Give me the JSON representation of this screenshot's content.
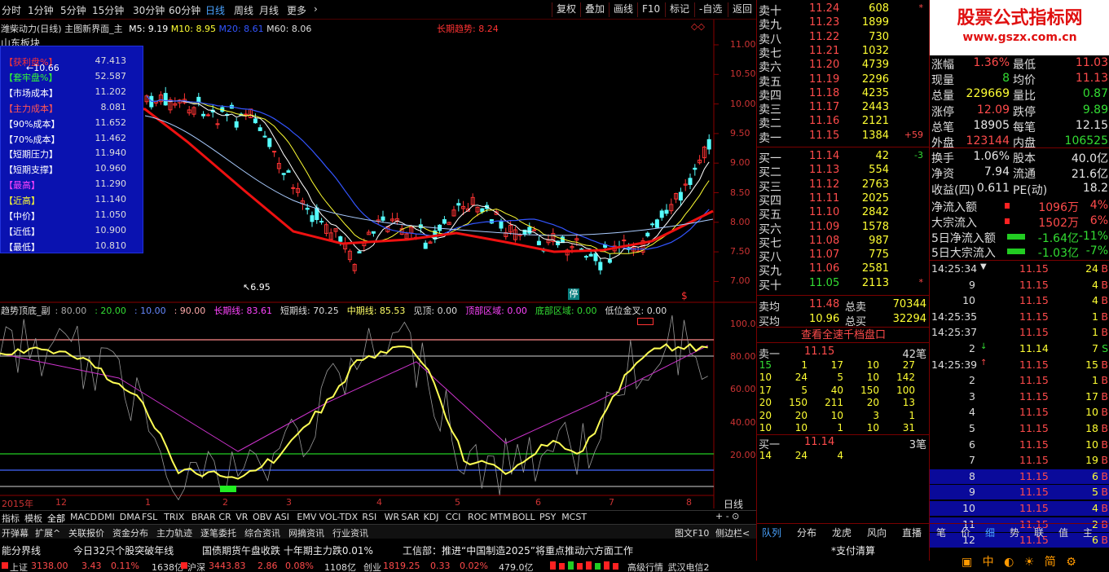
{
  "toolbar": {
    "periods": [
      "分时",
      "1分钟",
      "5分钟",
      "15分钟",
      "30分钟",
      "60分钟",
      "日线",
      "周线",
      "月线",
      "更多"
    ],
    "active_period": "日线",
    "right": [
      "复权",
      "叠加",
      "画线",
      "F10",
      "标记",
      "-自选",
      "返回"
    ]
  },
  "header": {
    "stock": "潍柴动力(日线)",
    "screen": "主图新界面_主",
    "ma": [
      "M5: 9.19",
      "M10: 8.95",
      "M20: 8.61",
      "M60: 8.06"
    ],
    "trend": "长期趋势: 8.24",
    "sector": "山东板块"
  },
  "info_box": [
    {
      "k": "【获利盘%】",
      "v": "47.413",
      "c": "#ff3333"
    },
    {
      "k": "【套牢盘%】",
      "v": "52.587",
      "c": "#33ff33"
    },
    {
      "k": "【市场成本】",
      "v": "11.202",
      "c": "#ffffff"
    },
    {
      "k": "【主力成本】",
      "v": "8.081",
      "c": "#ff5555"
    },
    {
      "k": "【90%成本】",
      "v": "11.652",
      "c": "#ffffff"
    },
    {
      "k": "【70%成本】",
      "v": "11.462",
      "c": "#ffffff"
    },
    {
      "k": "【短期压力】",
      "v": "11.940",
      "c": "#ffffff"
    },
    {
      "k": "【短期支撑】",
      "v": "10.960",
      "c": "#ffffff"
    },
    {
      "k": "【最高】",
      "v": "11.290",
      "c": "#ff44ff"
    },
    {
      "k": "【近高】",
      "v": "11.140",
      "c": "#ffff33"
    },
    {
      "k": "【中价】",
      "v": "11.050",
      "c": "#ffffff"
    },
    {
      "k": "【近低】",
      "v": "10.900",
      "c": "#ffffff"
    },
    {
      "k": "【最低】",
      "v": "10.810",
      "c": "#ffffff"
    }
  ],
  "price_axis": [
    "11.00",
    "10.50",
    "10.00",
    "9.50",
    "9.00",
    "8.50",
    "8.00",
    "7.50",
    "7.00"
  ],
  "annotations": {
    "high": "10.66",
    "low": "6.95"
  },
  "indicator": {
    "title": "趋势顶底_副",
    "values": [
      {
        "t": ": 80.00",
        "c": "#aaaaaa"
      },
      {
        "t": ": 20.00",
        "c": "#33dd33"
      },
      {
        "t": ": 10.00",
        "c": "#6688ff"
      },
      {
        "t": ": 90.00",
        "c": "#ffaaaa"
      },
      {
        "t": "长期线: 83.61",
        "c": "#ff44ff"
      },
      {
        "t": "短期线: 70.25",
        "c": "#dddddd"
      },
      {
        "t": "中期线: 85.53",
        "c": "#ffff66"
      },
      {
        "t": "见顶: 0.00",
        "c": "#dddddd"
      },
      {
        "t": "顶部区域: 0.00",
        "c": "#ff44ff"
      },
      {
        "t": "底部区域: 0.00",
        "c": "#33dd33"
      },
      {
        "t": "低位金叉: 0.00",
        "c": "#dddddd"
      }
    ],
    "axis": [
      "100.0",
      "80.00",
      "60.00",
      "40.00",
      "20.00"
    ]
  },
  "date_axis": [
    "2015年",
    "12",
    "1",
    "2",
    "3",
    "4",
    "5",
    "6",
    "7",
    "8"
  ],
  "date_axis_right": "日线",
  "indicator_tabs": [
    "指标",
    "模板",
    "全部",
    "MACD",
    "DMI",
    "DMA",
    "FSL",
    "TRIX",
    "BRAR",
    "CR",
    "VR",
    "OBV",
    "ASI",
    "EMV",
    "VOL-TDX",
    "RSI",
    "WR",
    "SAR",
    "KDJ",
    "CCI",
    "ROC",
    "MTM",
    "BOLL",
    "PSY",
    "MCST"
  ],
  "func_tabs": [
    "开弹幕",
    "扩展^",
    "关联报价",
    "资金分布",
    "主力轨迹",
    "逐笔委托",
    "综合资讯",
    "网摘资讯",
    "行业资讯"
  ],
  "func_right": [
    "图文F10",
    "侧边栏<"
  ],
  "sell": [
    {
      "n": "卖十",
      "p": "11.24",
      "v": "608",
      "x": "*"
    },
    {
      "n": "卖九",
      "p": "11.23",
      "v": "1899"
    },
    {
      "n": "卖八",
      "p": "11.22",
      "v": "730"
    },
    {
      "n": "卖七",
      "p": "11.21",
      "v": "1032"
    },
    {
      "n": "卖六",
      "p": "11.20",
      "v": "4739"
    },
    {
      "n": "卖五",
      "p": "11.19",
      "v": "2296"
    },
    {
      "n": "卖四",
      "p": "11.18",
      "v": "4235"
    },
    {
      "n": "卖三",
      "p": "11.17",
      "v": "2443"
    },
    {
      "n": "卖二",
      "p": "11.16",
      "v": "2121"
    },
    {
      "n": "卖一",
      "p": "11.15",
      "v": "1384",
      "x": "+59"
    }
  ],
  "buy": [
    {
      "n": "买一",
      "p": "11.14",
      "v": "42",
      "x": "-3"
    },
    {
      "n": "买二",
      "p": "11.13",
      "v": "554"
    },
    {
      "n": "买三",
      "p": "11.12",
      "v": "2763"
    },
    {
      "n": "买四",
      "p": "11.11",
      "v": "2025"
    },
    {
      "n": "买五",
      "p": "11.10",
      "v": "2842"
    },
    {
      "n": "买六",
      "p": "11.09",
      "v": "1578"
    },
    {
      "n": "买七",
      "p": "11.08",
      "v": "987"
    },
    {
      "n": "买八",
      "p": "11.07",
      "v": "775"
    },
    {
      "n": "买九",
      "p": "11.06",
      "v": "2581"
    },
    {
      "n": "买十",
      "p": "11.05",
      "v": "2113",
      "x": "*"
    }
  ],
  "avg": {
    "sell_l": "卖均",
    "sell_p": "11.48",
    "sell_t": "总卖",
    "sell_v": "70344",
    "buy_l": "买均",
    "buy_p": "10.96",
    "buy_t": "总买",
    "buy_v": "32294"
  },
  "fast_btn": "查看全速千档盘口",
  "s1": {
    "l": "卖一",
    "p": "11.15",
    "c": "42笔",
    "rows": [
      [
        "15",
        "1",
        "17",
        "10",
        "27"
      ],
      [
        "10",
        "24",
        "5",
        "10",
        "142"
      ],
      [
        "17",
        "5",
        "40",
        "150",
        "100"
      ],
      [
        "20",
        "150",
        "211",
        "20",
        "13"
      ],
      [
        "20",
        "20",
        "10",
        "3",
        "1"
      ],
      [
        "10",
        "10",
        "1",
        "10",
        "31"
      ]
    ]
  },
  "b1": {
    "l": "买一",
    "p": "11.14",
    "c": "3笔",
    "rows": [
      [
        "14",
        "24",
        "4"
      ]
    ]
  },
  "qtabs": [
    "队列",
    "分布",
    "龙虎",
    "风向",
    "直播"
  ],
  "watermark": {
    "t1": "股票公式指标网",
    "t2": "www.gszx.com.cn"
  },
  "stats": [
    {
      "k1": "涨幅",
      "v1": "1.36%",
      "c1": "#ff4b4b",
      "k2": "最低",
      "v2": "11.03",
      "c2": "#ff4b4b"
    },
    {
      "k1": "现量",
      "v1": "8",
      "c1": "#33dd33",
      "k2": "均价",
      "v2": "11.13",
      "c2": "#ff4b4b"
    },
    {
      "k1": "总量",
      "v1": "229669",
      "c1": "#ffff33",
      "k2": "量比",
      "v2": "0.87",
      "c2": "#33dd33"
    },
    {
      "k1": "涨停",
      "v1": "12.09",
      "c1": "#ff4b4b",
      "k2": "跌停",
      "v2": "9.89",
      "c2": "#33dd33"
    },
    {
      "k1": "总笔",
      "v1": "18905",
      "c1": "#e6e6e6",
      "k2": "每笔",
      "v2": "12.15",
      "c2": "#e6e6e6"
    },
    {
      "k1": "外盘",
      "v1": "123144",
      "c1": "#ff4b4b",
      "k2": "内盘",
      "v2": "106525",
      "c2": "#33dd33"
    },
    {
      "k1": "换手",
      "v1": "1.06%",
      "c1": "#e6e6e6",
      "k2": "股本",
      "v2": "40.0亿",
      "c2": "#e6e6e6"
    },
    {
      "k1": "净资",
      "v1": "7.94",
      "c1": "#e6e6e6",
      "k2": "流通",
      "v2": "21.6亿",
      "c2": "#e6e6e6"
    },
    {
      "k1": "收益(四)",
      "v1": "0.611",
      "c1": "#e6e6e6",
      "k2": "PE(动)",
      "v2": "18.2",
      "c2": "#e6e6e6"
    }
  ],
  "flows": [
    {
      "k": "净流入额",
      "v": "1096万",
      "p": "4%",
      "c": "#ff4b4b",
      "bar": "red"
    },
    {
      "k": "大宗流入",
      "v": "1502万",
      "p": "6%",
      "c": "#ff4b4b",
      "bar": "red"
    },
    {
      "k": "5日净流入额",
      "v": "-1.64亿",
      "p": "-11%",
      "c": "#33dd33",
      "bar": "green"
    },
    {
      "k": "5日大宗流入",
      "v": "-1.03亿",
      "p": "-7%",
      "c": "#33dd33",
      "bar": "green"
    }
  ],
  "ticks": [
    {
      "t": "14:25:34",
      "p": "11.15",
      "v": "24",
      "s": "B",
      "a": "▼",
      "hl": false
    },
    {
      "t": "9",
      "p": "11.15",
      "v": "4",
      "s": "B",
      "hl": false
    },
    {
      "t": "10",
      "p": "11.15",
      "v": "4",
      "s": "B",
      "hl": false
    },
    {
      "t": "14:25:35",
      "p": "11.15",
      "v": "1",
      "s": "B",
      "hl": false
    },
    {
      "t": "14:25:37",
      "p": "11.15",
      "v": "1",
      "s": "B",
      "hl": false
    },
    {
      "t": "2",
      "p": "11.14",
      "v": "7",
      "s": "S",
      "a": "↓",
      "hl": false
    },
    {
      "t": "14:25:39",
      "p": "11.15",
      "v": "15",
      "s": "B",
      "a": "↑",
      "hl": false
    },
    {
      "t": "2",
      "p": "11.15",
      "v": "1",
      "s": "B",
      "hl": false
    },
    {
      "t": "3",
      "p": "11.15",
      "v": "17",
      "s": "B",
      "hl": false
    },
    {
      "t": "4",
      "p": "11.15",
      "v": "10",
      "s": "B",
      "hl": false
    },
    {
      "t": "5",
      "p": "11.15",
      "v": "18",
      "s": "B",
      "hl": false
    },
    {
      "t": "6",
      "p": "11.15",
      "v": "10",
      "s": "B",
      "hl": false
    },
    {
      "t": "7",
      "p": "11.15",
      "v": "19",
      "s": "B",
      "hl": false
    },
    {
      "t": "8",
      "p": "11.15",
      "v": "6",
      "s": "B",
      "hl": true
    },
    {
      "t": "9",
      "p": "11.15",
      "v": "5",
      "s": "B",
      "hl": true
    },
    {
      "t": "10",
      "p": "11.15",
      "v": "4",
      "s": "B",
      "hl": true
    },
    {
      "t": "11",
      "p": "11.15",
      "v": "2",
      "s": "B",
      "hl": true
    },
    {
      "t": "12",
      "p": "11.15",
      "v": "6",
      "s": "B",
      "hl": true
    }
  ],
  "rtabs": [
    "笔",
    "价",
    "细",
    "势",
    "联",
    "值",
    "主"
  ],
  "news": [
    "能分界线",
    "今日32只个股突破年线",
    "国债期货午盘收跌 十年期主力跌0.01%",
    "工信部：推进“中国制造2025”将重点推动六方面工作",
    "*支付清算"
  ],
  "status": {
    "sh_l": "上证",
    "sh_v": "3138.00",
    "sh_c": "3.43",
    "sh_p": "0.11%",
    "sh_a": "1638亿",
    "hs_l": "沪深",
    "hs_v": "3443.83",
    "hs_c": "2.86",
    "hs_p": "0.08%",
    "hs_a": "1108亿",
    "cy_l": "创业",
    "cy_v": "1819.25",
    "cy_c": "0.33",
    "cy_p": "0.02%",
    "cy_a": "479.0亿",
    "server": "高级行情_武汉电信2"
  }
}
